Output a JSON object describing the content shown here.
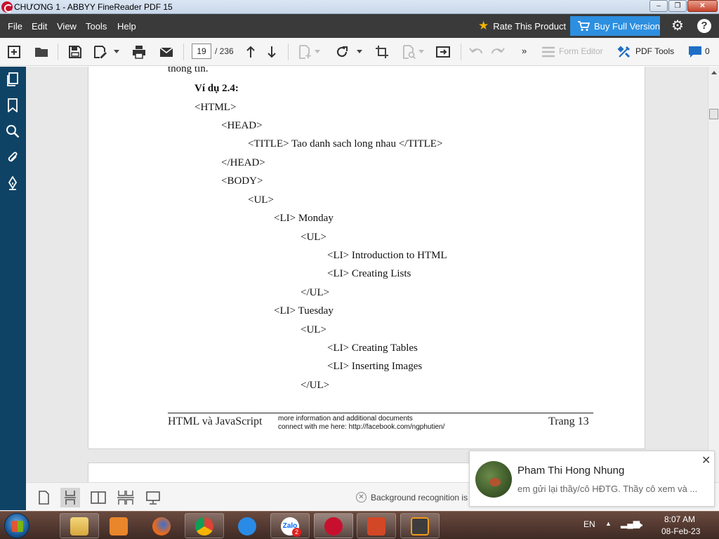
{
  "window": {
    "title": "CHƯƠNG 1 - ABBYY FineReader PDF 15",
    "minimize": "–",
    "maximize": "❐",
    "close": "✕"
  },
  "menu": {
    "items": [
      "File",
      "Edit",
      "View",
      "Tools",
      "Help"
    ],
    "rate": "Rate This Product",
    "buy": "Buy Full Version"
  },
  "toolbar": {
    "page_current": "19",
    "page_total": "/ 236",
    "overflow": "»",
    "form_editor": "Form Editor",
    "pdf_tools": "PDF Tools",
    "comments_count": "0"
  },
  "document": {
    "lines": [
      "thông tin.",
      "Ví dụ 2.4:",
      "<HTML>",
      "<HEAD>",
      "<TITLE> Tao danh sach long nhau </TITLE>",
      "</HEAD>",
      "<BODY>",
      "<UL>",
      "<LI> Monday",
      "<UL>",
      "<LI> Introduction to HTML",
      "<LI> Creating Lists",
      "</UL>",
      "<LI> Tuesday",
      "<UL>",
      "<LI> Creating Tables",
      "<LI> Inserting Images",
      "</UL>"
    ],
    "footer_left": "HTML và JavaScript",
    "footer_note_1": "more information and additional documents",
    "footer_note_2": "connect with me here: http://facebook.com/ngphutien/",
    "footer_right": "Trang 13"
  },
  "statusbar": {
    "background_recognition": "Background recognition is"
  },
  "notification": {
    "name": "Pham Thi Hong Nhung",
    "message": "em gửi lại thầy/cô HĐTG. Thầy cô xem và ...",
    "close": "✕"
  },
  "taskbar": {
    "language": "EN",
    "time": "8:07 AM",
    "date": "08-Feb-23",
    "zalo_label": "Zalo",
    "zalo_badge": "2"
  },
  "colors": {
    "menubar": "#3a3a3a",
    "accent": "#2d8fe0",
    "sidebar": "#0f4366",
    "star": "#f5b400"
  }
}
